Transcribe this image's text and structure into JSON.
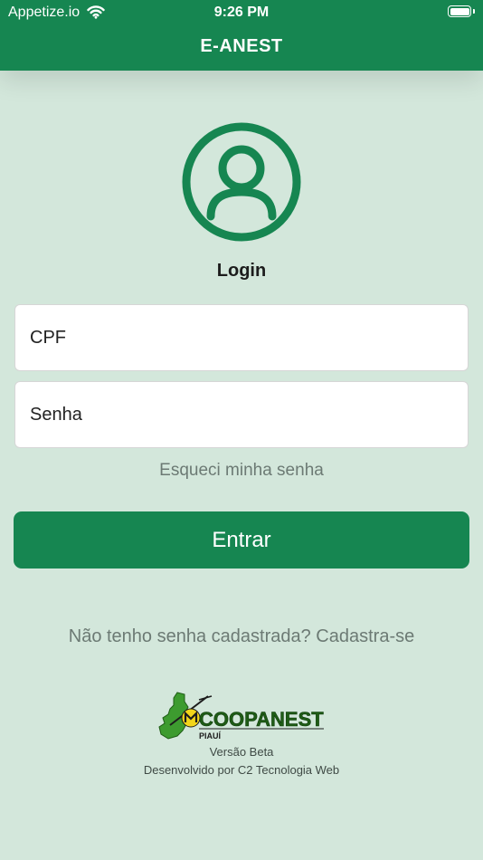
{
  "status_bar": {
    "carrier": "Appetize.io",
    "time": "9:26 PM",
    "wifi_icon": "wifi-icon",
    "battery_icon": "battery-icon"
  },
  "header": {
    "title": "E-ANEST"
  },
  "login": {
    "avatar_icon": "user-circle-icon",
    "heading": "Login",
    "cpf_placeholder": "CPF",
    "password_placeholder": "Senha",
    "forgot_password": "Esqueci minha senha",
    "submit_label": "Entrar",
    "register_link": "Não tenho senha cadastrada? Cadastra-se"
  },
  "footer": {
    "logo_text": "COOPANEST",
    "logo_subtext": "PIAUÍ",
    "version": "Versão Beta",
    "developer": "Desenvolvido por C2 Tecnologia Web"
  },
  "colors": {
    "primary": "#168651",
    "background": "#d3e7db",
    "logo_yellow": "#f2d51b",
    "muted_text": "#6c7a74"
  }
}
